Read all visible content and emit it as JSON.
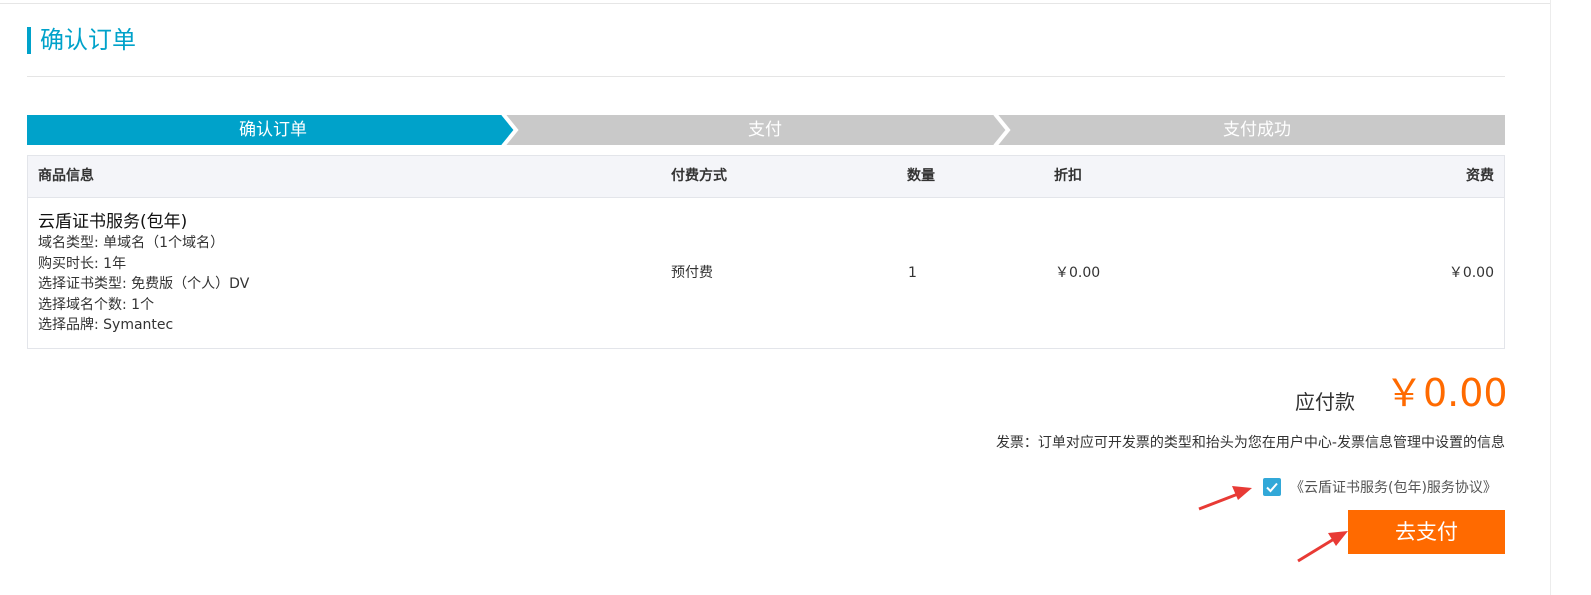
{
  "page": {
    "title": "确认订单"
  },
  "steps": [
    {
      "label": "确认订单",
      "active": true
    },
    {
      "label": "支付",
      "active": false
    },
    {
      "label": "支付成功",
      "active": false
    }
  ],
  "table": {
    "headers": {
      "product": "商品信息",
      "payment": "付费方式",
      "quantity": "数量",
      "discount": "折扣",
      "fee": "资费"
    },
    "row": {
      "product_name": "云盾证书服务(包年)",
      "specs": [
        "域名类型: 单域名（1个域名）",
        "购买时长: 1年",
        "选择证书类型: 免费版（个人）DV",
        "选择域名个数: 1个",
        "选择品牌: Symantec"
      ],
      "payment": "预付费",
      "quantity": "1",
      "discount": "￥0.00",
      "fee": "￥0.00"
    }
  },
  "summary": {
    "payable_label": "应付款",
    "payable_amount": "￥0.00",
    "invoice_note": "发票：订单对应可开发票的类型和抬头为您在用户中心-发票信息管理中设置的信息"
  },
  "agreement": {
    "checked": true,
    "label": "《云盾证书服务(包年)服务协议》"
  },
  "pay_button": {
    "label": "去支付"
  },
  "colors": {
    "accent": "#00a2ca",
    "step_inactive": "#c9c9c9",
    "pay": "#ff6a00",
    "annotation": "#e83a35"
  }
}
